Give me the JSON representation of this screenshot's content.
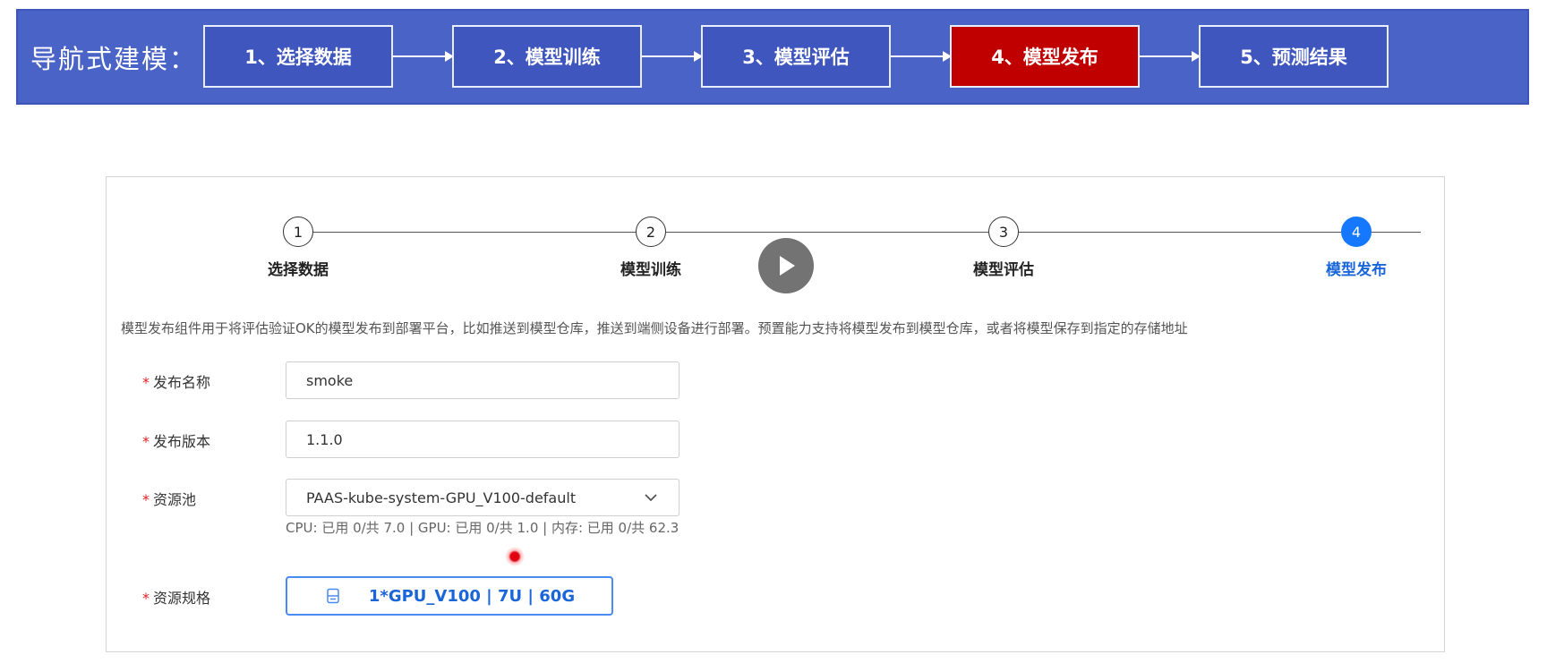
{
  "nav": {
    "title": "导航式建模：",
    "steps": [
      {
        "label": "1、选择数据"
      },
      {
        "label": "2、模型训练"
      },
      {
        "label": "3、模型评估"
      },
      {
        "label": "4、模型发布"
      },
      {
        "label": "5、预测结果"
      }
    ],
    "active_color": "#c00000",
    "banner_color": "#4a63c6"
  },
  "stepper": {
    "steps": [
      {
        "number": "1",
        "label": "选择数据"
      },
      {
        "number": "2",
        "label": "模型训练"
      },
      {
        "number": "3",
        "label": "模型评估"
      },
      {
        "number": "4",
        "label": "模型发布"
      }
    ],
    "current_index": 4,
    "current_color": "#1677ff"
  },
  "description": "模型发布组件用于将评估验证OK的模型发布到部署平台，比如推送到模型仓库，推送到端侧设备进行部署。预置能力支持将模型发布到模型仓库，或者将模型保存到指定的存储地址",
  "form": {
    "required_mark": "*",
    "release_name": {
      "label": "发布名称",
      "value": "smoke"
    },
    "release_version": {
      "label": "发布版本",
      "value": "1.1.0"
    },
    "resource_pool": {
      "label": "资源池",
      "value": "PAAS-kube-system-GPU_V100-default",
      "info": "CPU: 已用 0/共 7.0 | GPU: 已用 0/共 1.0 | 内存: 已用 0/共 62.3"
    },
    "resource_spec": {
      "label": "资源规格",
      "value": "1*GPU_V100 | 7U | 60G"
    }
  },
  "icons": {
    "play": "play-icon",
    "chevron": "chevron-down-icon",
    "spec": "server-icon"
  }
}
